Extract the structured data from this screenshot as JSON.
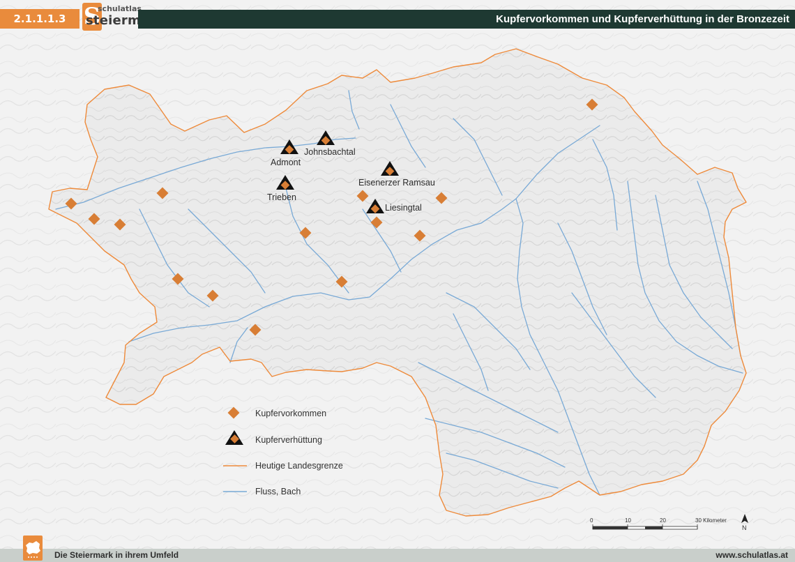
{
  "header": {
    "code": "2.1.1.1.3",
    "logo_top": "schulatlas",
    "logo_main": "steiermark",
    "logo_letter": "S",
    "title": "Kupfervorkommen und Kupferverhüttung in der Bronzezeit"
  },
  "footer": {
    "left": "Die Steiermark in ihrem Umfeld",
    "right": "www.schulatlas.at"
  },
  "places": [
    {
      "name": "Johnsbachtal"
    },
    {
      "name": "Admont"
    },
    {
      "name": "Eisenerzer Ramsau"
    },
    {
      "name": "Trieben"
    },
    {
      "name": "Liesingtal"
    }
  ],
  "legend": {
    "deposit": "Kupfervorkommen",
    "smelting": "Kupferverhüttung",
    "border": "Heutige Landesgrenze",
    "river": "Fluss, Bach"
  },
  "scale": {
    "ticks": [
      "0",
      "10",
      "20",
      "30 Kilometer"
    ],
    "north": "N"
  },
  "colors": {
    "border": "#ee8a3a",
    "river": "#78a9d6",
    "symbol_orange": "#d87e35",
    "header_dark": "#1e3932",
    "header_orange": "#e98b3c"
  }
}
